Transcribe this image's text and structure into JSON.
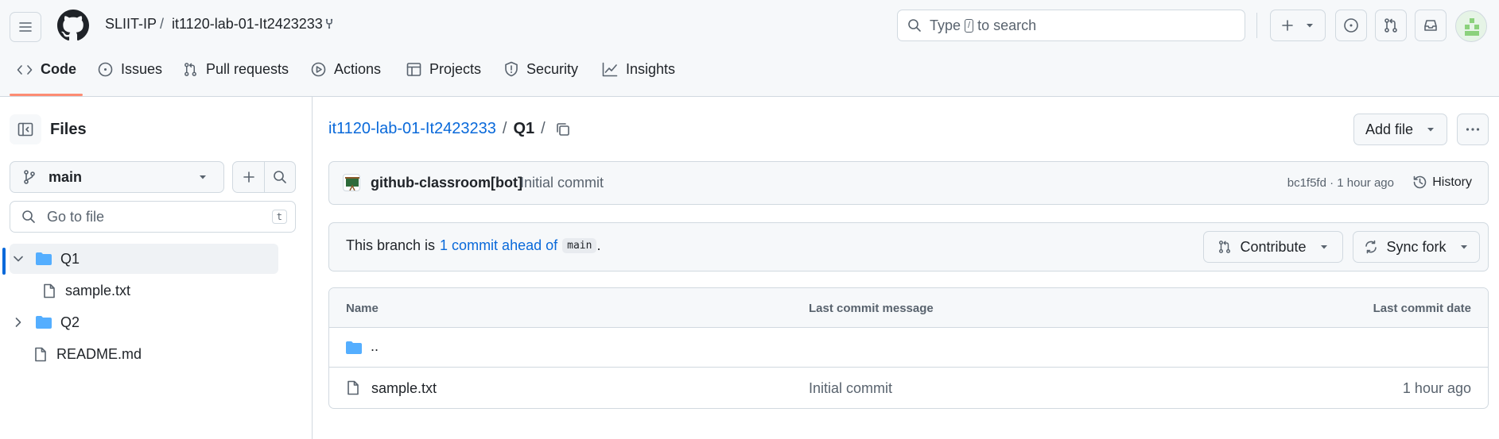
{
  "header": {
    "org": "SLIIT-IP",
    "separator": "/",
    "repo": "it1120-lab-01-It2423233",
    "search_text_before": "Type",
    "search_key": "/",
    "search_text_after": "to search"
  },
  "tabs": [
    {
      "label": "Code",
      "icon": "code-icon"
    },
    {
      "label": "Issues",
      "icon": "issue-icon"
    },
    {
      "label": "Pull requests",
      "icon": "pull-request-icon"
    },
    {
      "label": "Actions",
      "icon": "play-icon"
    },
    {
      "label": "Projects",
      "icon": "table-icon"
    },
    {
      "label": "Security",
      "icon": "shield-icon"
    },
    {
      "label": "Insights",
      "icon": "graph-icon"
    }
  ],
  "sidebar": {
    "title": "Files",
    "branch": "main",
    "go_to_file_placeholder": "Go to file",
    "go_to_file_key": "t",
    "tree": [
      {
        "name": "Q1",
        "type": "folder",
        "expanded": true
      },
      {
        "name": "sample.txt",
        "type": "file"
      },
      {
        "name": "Q2",
        "type": "folder",
        "expanded": false
      },
      {
        "name": "README.md",
        "type": "file"
      }
    ]
  },
  "main": {
    "breadcrumb_repo": "it1120-lab-01-It2423233",
    "breadcrumb_sep": "/",
    "breadcrumb_folder": "Q1",
    "add_file_label": "Add file",
    "commit": {
      "author": "github-classroom[bot]",
      "message": "Initial commit",
      "meta": "bc1f5fd · 1 hour ago",
      "history_label": "History"
    },
    "branch_status": {
      "prefix": "This branch is",
      "ahead_link": "1 commit ahead of",
      "base": "main",
      "suffix": "."
    },
    "contribute_label": "Contribute",
    "sync_fork_label": "Sync fork",
    "table": {
      "headers": [
        "Name",
        "Last commit message",
        "Last commit date"
      ],
      "parent_row": "..",
      "rows": [
        {
          "name": "sample.txt",
          "message": "Initial commit",
          "date": "1 hour ago"
        }
      ]
    }
  },
  "colors": {
    "accent": "#0969da",
    "folder": "#54aeff",
    "tab_underline": "#fd8c73",
    "border": "#d1d9e0"
  }
}
